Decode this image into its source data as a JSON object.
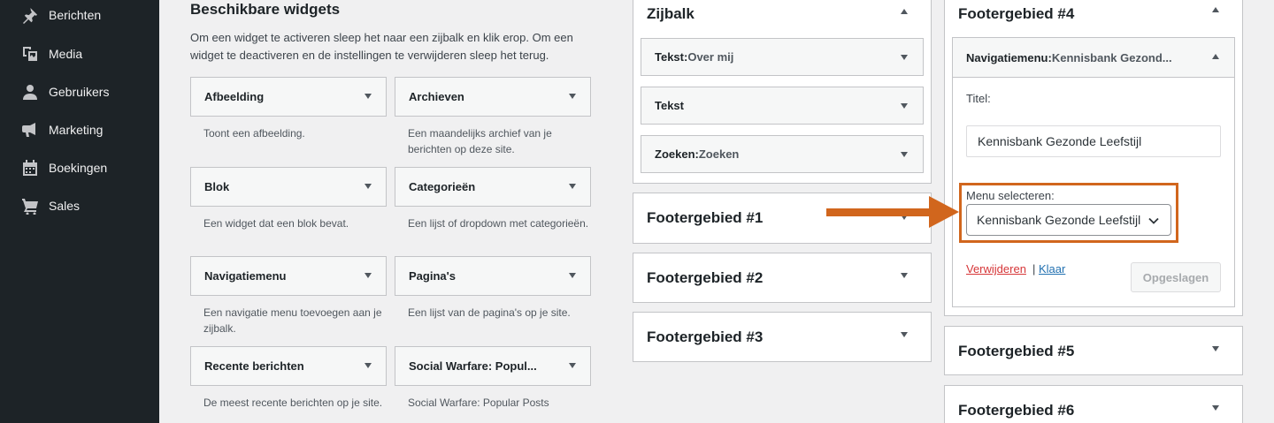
{
  "sidebar": {
    "items": [
      {
        "label": "Berichten",
        "icon": "pin-icon"
      },
      {
        "label": "Media",
        "icon": "media-icon"
      },
      {
        "label": "Gebruikers",
        "icon": "user-icon"
      },
      {
        "label": "Marketing",
        "icon": "megaphone-icon"
      },
      {
        "label": "Boekingen",
        "icon": "calendar-icon"
      },
      {
        "label": "Sales",
        "icon": "cart-icon"
      }
    ]
  },
  "available": {
    "title": "Beschikbare widgets",
    "description": "Om een widget te activeren sleep het naar een zijbalk en klik erop. Om een widget te deactiveren en de instellingen te verwijderen sleep het terug.",
    "widgets": [
      {
        "label": "Afbeelding",
        "desc": "Toont een afbeelding."
      },
      {
        "label": "Archieven",
        "desc": "Een maandelijks archief van je berichten op deze site."
      },
      {
        "label": "Blok",
        "desc": "Een widget dat een blok bevat."
      },
      {
        "label": "Categorieën",
        "desc": "Een lijst of dropdown met categorieën."
      },
      {
        "label": "Navigatiemenu",
        "desc": "Een navigatie menu toevoegen aan je zijbalk."
      },
      {
        "label": "Pagina's",
        "desc": "Een lijst van de pagina's op je site."
      },
      {
        "label": "Recente berichten",
        "desc": "De meest recente berichten op je site."
      },
      {
        "label": "Social Warfare: Popul...",
        "desc": "Social Warfare: Popular Posts"
      }
    ]
  },
  "zijbalk": {
    "title": "Zijbalk",
    "widgets": [
      {
        "name": "Tekst",
        "sep": ":",
        "sub": " Over mij"
      },
      {
        "name": "Tekst",
        "sep": "",
        "sub": ""
      },
      {
        "name": "Zoeken",
        "sep": ":",
        "sub": " Zoeken"
      }
    ]
  },
  "footers_left": [
    "Footergebied #1",
    "Footergebied #2",
    "Footergebied #3"
  ],
  "footer4": {
    "title": "Footergebied #4",
    "widget_name": "Navigatiemenu",
    "widget_sep": ":",
    "widget_sub": " Kennisbank Gezond...",
    "title_label": "Titel:",
    "title_value": "Kennisbank Gezonde Leefstijl",
    "menu_label": "Menu selecteren:",
    "menu_value": "Kennisbank Gezonde Leefstijl",
    "delete_label": "Verwijderen",
    "divider": "|",
    "done_label": "Klaar",
    "saved_label": "Opgeslagen"
  },
  "footers_right": [
    "Footergebied #5",
    "Footergebied #6"
  ],
  "colors": {
    "highlight": "#d1661d",
    "sidebar_bg": "#1d2327",
    "delete_link": "#d63638",
    "done_link": "#2271b1"
  }
}
